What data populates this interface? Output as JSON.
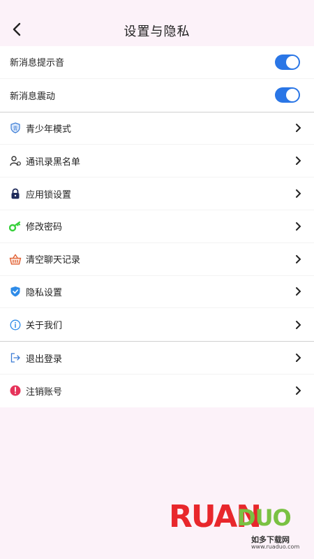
{
  "header": {
    "title": "设置与隐私"
  },
  "toggles": [
    {
      "label": "新消息提示音",
      "on": true
    },
    {
      "label": "新消息震动",
      "on": true
    }
  ],
  "menu": [
    {
      "label": "青少年模式",
      "icon": "teen-shield-icon"
    },
    {
      "label": "通讯录黑名单",
      "icon": "user-blacklist-icon"
    },
    {
      "label": "应用锁设置",
      "icon": "lock-icon"
    },
    {
      "label": "修改密码",
      "icon": "key-icon"
    },
    {
      "label": "清空聊天记录",
      "icon": "basket-icon"
    },
    {
      "label": "隐私设置",
      "icon": "privacy-shield-icon"
    },
    {
      "label": "关于我们",
      "icon": "info-icon"
    }
  ],
  "account": [
    {
      "label": "退出登录",
      "icon": "logout-icon"
    },
    {
      "label": "注销账号",
      "icon": "alert-icon"
    }
  ],
  "watermark": {
    "brand": "RUANDUO",
    "brand_a": "RUAN",
    "brand_b": "DUO",
    "cn": "如多下载网",
    "url": "www.ruaduo.com"
  },
  "colors": {
    "accent": "#2a76e6",
    "background": "#fcf2f9"
  }
}
